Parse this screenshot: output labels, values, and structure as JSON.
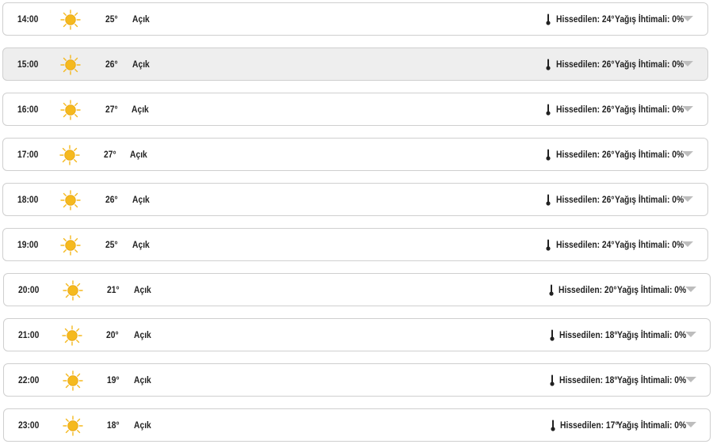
{
  "icons": {
    "weather": "sun-icon",
    "feels_like": "thermometer-icon",
    "expand": "chevron-down-icon"
  },
  "colors": {
    "sun": "#F5B91E",
    "chevron": "#BDBDBD",
    "highlight_row": "#EEEEEE"
  },
  "rows": [
    {
      "time": "14:00",
      "temp": "25°",
      "condition": "Açık",
      "feels_like": "Hissedilen: 24°",
      "rain": "Yağış İhtimali: 0%"
    },
    {
      "time": "15:00",
      "temp": "26°",
      "condition": "Açık",
      "feels_like": "Hissedilen: 26°",
      "rain": "Yağış İhtimali: 0%"
    },
    {
      "time": "16:00",
      "temp": "27°",
      "condition": "Açık",
      "feels_like": "Hissedilen: 26°",
      "rain": "Yağış İhtimali: 0%"
    },
    {
      "time": "17:00",
      "temp": "27°",
      "condition": "Açık",
      "feels_like": "Hissedilen: 26°",
      "rain": "Yağış İhtimali: 0%"
    },
    {
      "time": "18:00",
      "temp": "26°",
      "condition": "Açık",
      "feels_like": "Hissedilen: 26°",
      "rain": "Yağış İhtimali: 0%"
    },
    {
      "time": "19:00",
      "temp": "25°",
      "condition": "Açık",
      "feels_like": "Hissedilen: 24°",
      "rain": "Yağış İhtimali: 0%"
    },
    {
      "time": "20:00",
      "temp": "21°",
      "condition": "Açık",
      "feels_like": "Hissedilen: 20°",
      "rain": "Yağış İhtimali: 0%"
    },
    {
      "time": "21:00",
      "temp": "20°",
      "condition": "Açık",
      "feels_like": "Hissedilen: 18°",
      "rain": "Yağış İhtimali: 0%"
    },
    {
      "time": "22:00",
      "temp": "19°",
      "condition": "Açık",
      "feels_like": "Hissedilen: 18°",
      "rain": "Yağış İhtimali: 0%"
    },
    {
      "time": "23:00",
      "temp": "18°",
      "condition": "Açık",
      "feels_like": "Hissedilen: 17°",
      "rain": "Yağış İhtimali: 0%"
    }
  ]
}
